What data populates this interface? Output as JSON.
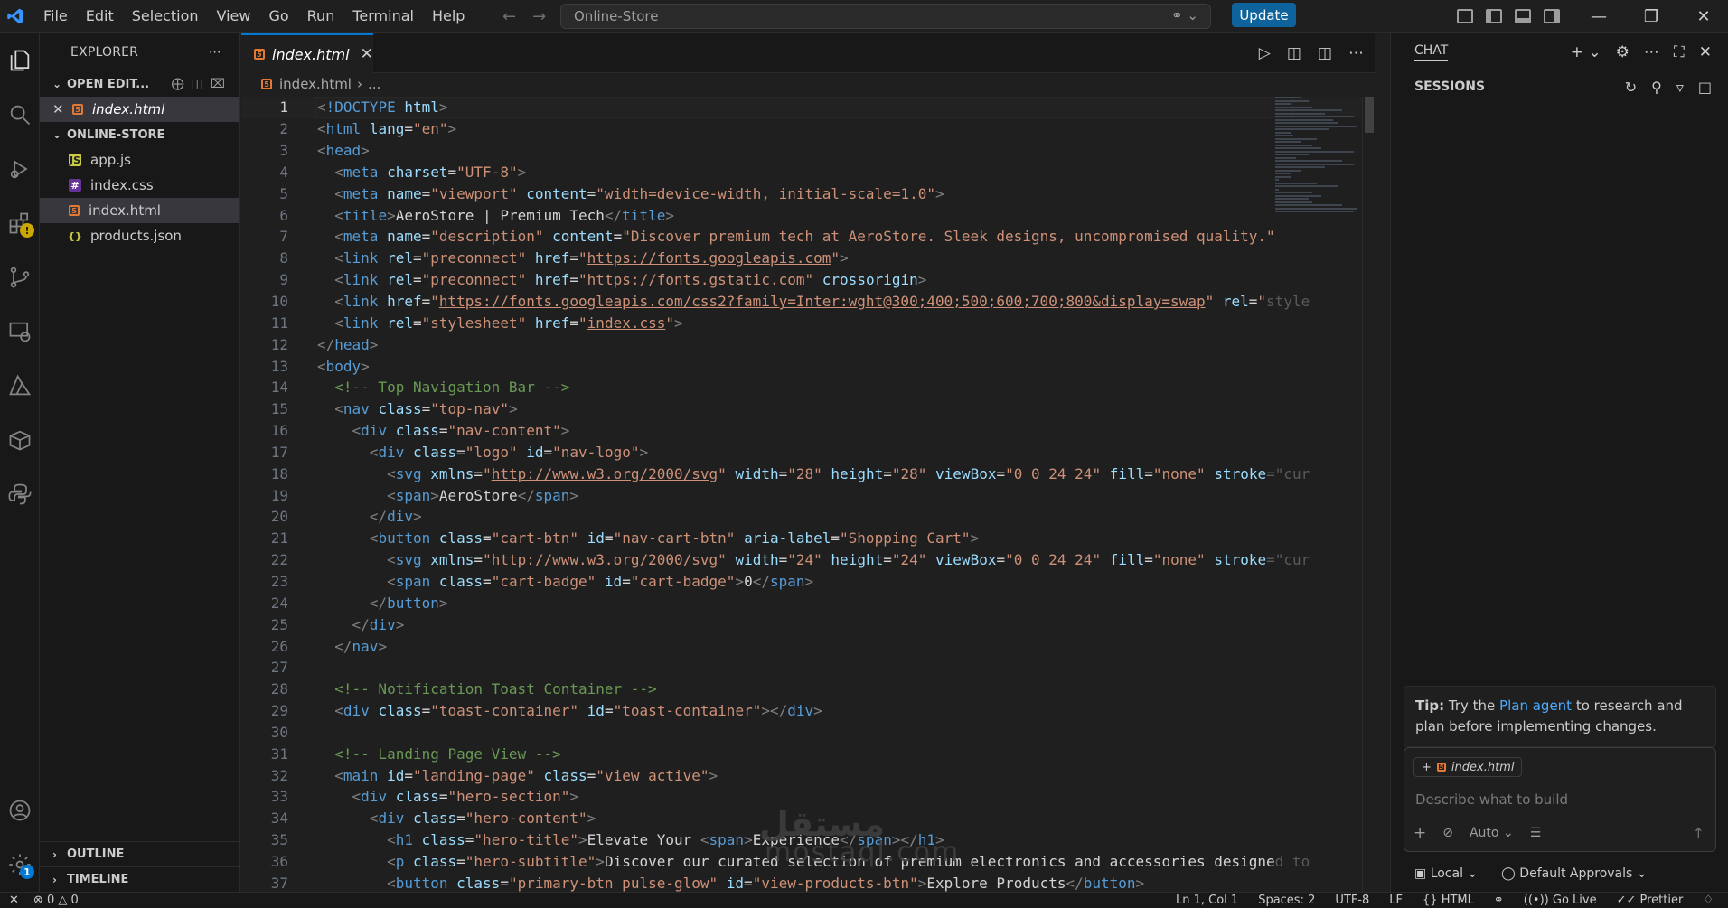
{
  "menu": [
    "File",
    "Edit",
    "Selection",
    "View",
    "Go",
    "Run",
    "Terminal",
    "Help"
  ],
  "command_center": {
    "text": "Online-Store"
  },
  "update_button": "Update",
  "explorer": {
    "title": "EXPLORER",
    "open_editors_label": "OPEN EDIT...",
    "open_editors": [
      {
        "name": "index.html"
      }
    ],
    "folder_label": "ONLINE-STORE",
    "files": [
      {
        "name": "app.js",
        "type": "js"
      },
      {
        "name": "index.css",
        "type": "css"
      },
      {
        "name": "index.html",
        "type": "html"
      },
      {
        "name": "products.json",
        "type": "json"
      }
    ],
    "outline_label": "OUTLINE",
    "timeline_label": "TIMELINE"
  },
  "editor": {
    "tab_label": "index.html",
    "breadcrumb_file": "index.html",
    "breadcrumb_rest": "...",
    "current_line": 1
  },
  "chat": {
    "title": "CHAT",
    "sessions_label": "SESSIONS",
    "tip_bold": "Tip:",
    "tip_pre": " Try the ",
    "tip_link": "Plan agent",
    "tip_post": " to research and plan before implementing changes.",
    "context_chip": "index.html",
    "input_placeholder": "Describe what to build",
    "mode": "Auto",
    "footer_local": "Local",
    "footer_approvals": "Default Approvals"
  },
  "status": {
    "errors": "0",
    "warnings": "0",
    "position": "Ln 1, Col 1",
    "spaces": "Spaces: 2",
    "encoding": "UTF-8",
    "eol": "LF",
    "language": "HTML",
    "golive": "Go Live",
    "prettier": "Prettier"
  },
  "watermark": {
    "arabic": "مستقل",
    "latin": "mostaql.com"
  },
  "badges": {
    "extensions": "!",
    "accounts": "1"
  }
}
